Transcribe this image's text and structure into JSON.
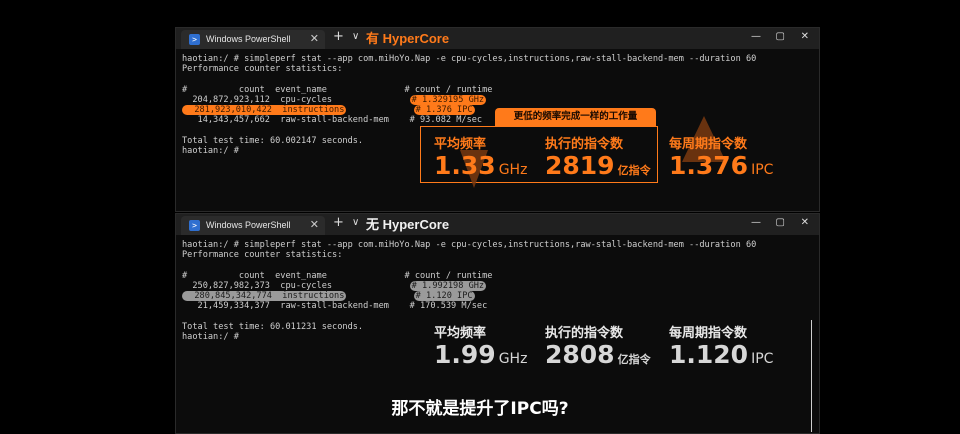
{
  "windows": [
    {
      "tab_title": "Windows PowerShell",
      "label": "有 HyperCore",
      "lines": [
        {
          "segments": [
            {
              "text": "haotian:/ # simpleperf stat --app com.miHoYo.Nap -e cpu-cycles,instructions,raw-stall-backend-mem --duration 60"
            }
          ]
        },
        {
          "segments": [
            {
              "text": "Performance counter statistics:"
            }
          ]
        },
        {
          "segments": [
            {
              "text": ""
            }
          ]
        },
        {
          "segments": [
            {
              "text": "#          count  event_name               # count / runtime"
            }
          ]
        },
        {
          "segments": [
            {
              "text": "  204,872,923,112  cpu-cycles               "
            },
            {
              "text": "# 1.329195 GHz",
              "hl": "o"
            }
          ]
        },
        {
          "segments": [
            {
              "text": "  281,923,010,422  instructions",
              "hl": "o"
            },
            {
              "text": "             "
            },
            {
              "text": "# 1.376 IPC",
              "hl": "o"
            }
          ]
        },
        {
          "segments": [
            {
              "text": "   14,343,457,662  raw-stall-backend-mem    # 93.082 M/sec"
            }
          ]
        },
        {
          "segments": [
            {
              "text": ""
            }
          ]
        },
        {
          "segments": [
            {
              "text": "Total test time: 60.002147 seconds."
            }
          ]
        },
        {
          "segments": [
            {
              "text": "haotian:/ #"
            }
          ]
        }
      ]
    },
    {
      "tab_title": "Windows PowerShell",
      "label": "无 HyperCore",
      "lines": [
        {
          "segments": [
            {
              "text": "haotian:/ # simpleperf stat --app com.miHoYo.Nap -e cpu-cycles,instructions,raw-stall-backend-mem --duration 60"
            }
          ]
        },
        {
          "segments": [
            {
              "text": "Performance counter statistics:"
            }
          ]
        },
        {
          "segments": [
            {
              "text": ""
            }
          ]
        },
        {
          "segments": [
            {
              "text": "#          count  event_name               # count / runtime"
            }
          ]
        },
        {
          "segments": [
            {
              "text": "  250,827,982,373  cpu-cycles               "
            },
            {
              "text": "# 1.992198 GHz",
              "hl": "g"
            }
          ]
        },
        {
          "segments": [
            {
              "text": "  280,845,342,774  instructions",
              "hl": "g"
            },
            {
              "text": "             "
            },
            {
              "text": "# 1.120 IPC",
              "hl": "g"
            }
          ]
        },
        {
          "segments": [
            {
              "text": "   21,459,334,377  raw-stall-backend-mem    # 170.539 M/sec"
            }
          ]
        },
        {
          "segments": [
            {
              "text": ""
            }
          ]
        },
        {
          "segments": [
            {
              "text": "Total test time: 60.011231 seconds."
            }
          ]
        },
        {
          "segments": [
            {
              "text": "haotian:/ #"
            }
          ]
        }
      ]
    }
  ],
  "window_controls": {
    "plus": "+",
    "chevron": "∨",
    "close": "✕",
    "minimize": "—",
    "maximize": "▢",
    "window_close": "✕"
  },
  "top_stats": {
    "callout": "更低的频率完成一样的工作量",
    "freq": {
      "label": "平均频率",
      "value": "1.33",
      "unit": "GHz"
    },
    "instr": {
      "label": "执行的指令数",
      "value": "2819",
      "unit": "亿指令"
    },
    "ipc": {
      "label": "每周期指令数",
      "value": "1.376",
      "unit": "IPC"
    }
  },
  "bottom_stats": {
    "freq": {
      "label": "平均频率",
      "value": "1.99",
      "unit": "GHz"
    },
    "instr": {
      "label": "执行的指令数",
      "value": "2808",
      "unit": "亿指令"
    },
    "ipc": {
      "label": "每周期指令数",
      "value": "1.120",
      "unit": "IPC"
    }
  },
  "subtitle": "那不就是提升了IPC吗?",
  "colors": {
    "accent": "#ff7a1a",
    "terminal_bg": "#0c0c0c",
    "tabbar_bg": "#202020"
  }
}
